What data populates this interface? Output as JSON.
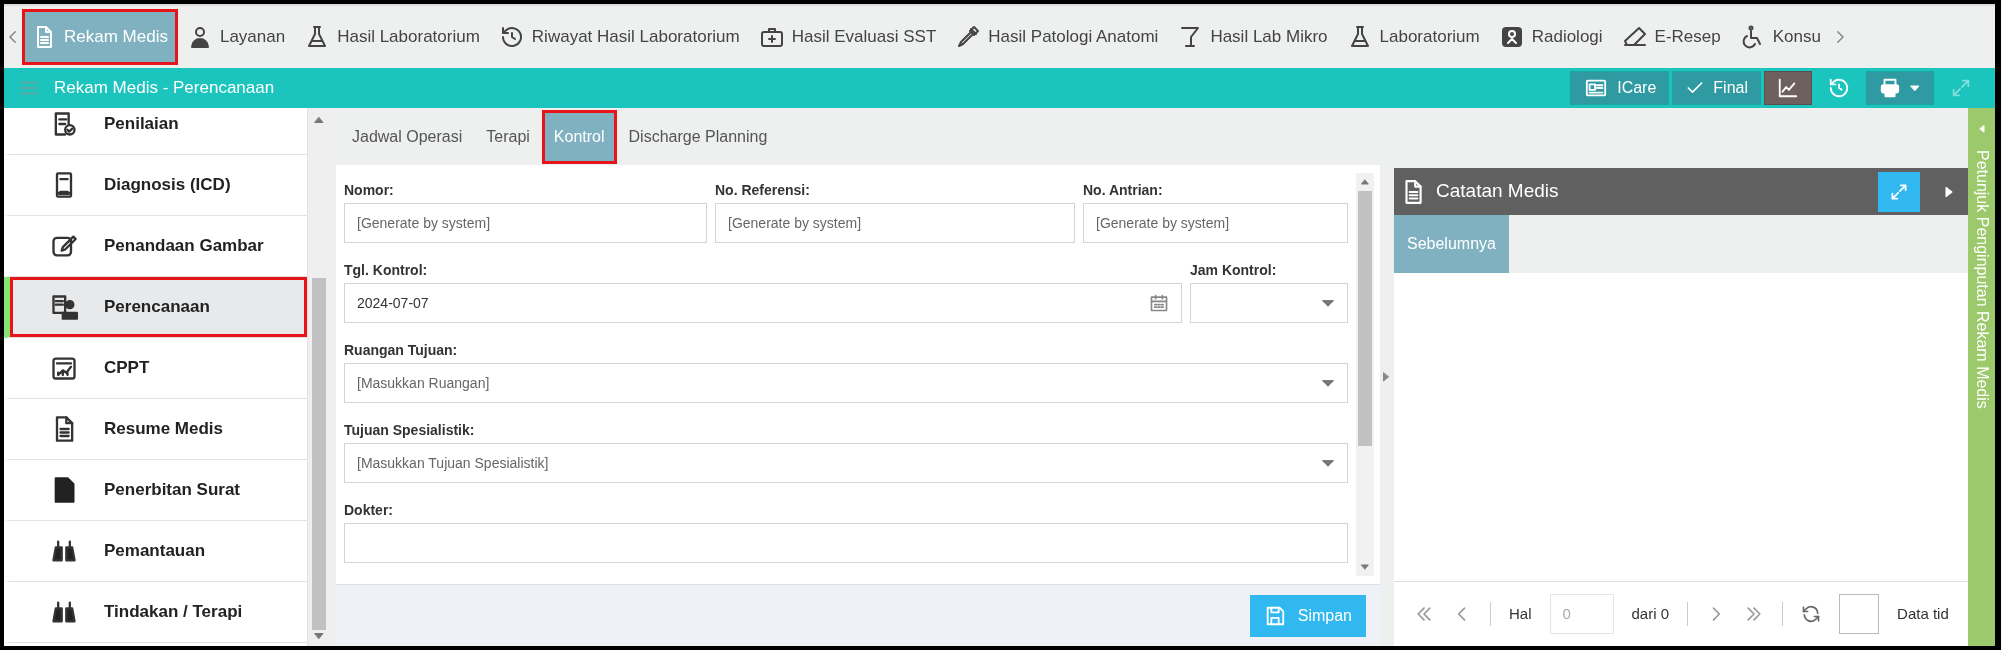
{
  "top_nav": {
    "items": [
      {
        "label": "Rekam Medis",
        "selected": true,
        "highlighted": true
      },
      {
        "label": "Layanan",
        "selected": false,
        "highlighted": false
      },
      {
        "label": "Hasil Laboratorium",
        "selected": false,
        "highlighted": false
      },
      {
        "label": "Riwayat Hasil Laboratorium",
        "selected": false,
        "highlighted": false
      },
      {
        "label": "Hasil Evaluasi SST",
        "selected": false,
        "highlighted": false
      },
      {
        "label": "Hasil Patologi Anatomi",
        "selected": false,
        "highlighted": false
      },
      {
        "label": "Hasil Lab Mikro",
        "selected": false,
        "highlighted": false
      },
      {
        "label": "Laboratorium",
        "selected": false,
        "highlighted": false
      },
      {
        "label": "Radiologi",
        "selected": false,
        "highlighted": false
      },
      {
        "label": "E-Resep",
        "selected": false,
        "highlighted": false
      },
      {
        "label": "Konsu",
        "selected": false,
        "highlighted": false
      }
    ]
  },
  "header": {
    "title": "Rekam Medis - Perencanaan",
    "buttons": [
      {
        "kind": "text",
        "label": "ICare",
        "selected": false
      },
      {
        "kind": "text",
        "label": "Final",
        "selected": false
      },
      {
        "kind": "chart",
        "selected": true
      },
      {
        "kind": "history",
        "selected": false
      },
      {
        "kind": "print",
        "selected": false
      },
      {
        "kind": "expand",
        "selected": false,
        "disabled": true
      }
    ]
  },
  "sidebar": {
    "items": [
      {
        "label": "Penilaian",
        "selected": false,
        "highlighted": false
      },
      {
        "label": "Diagnosis (ICD)",
        "selected": false,
        "highlighted": false
      },
      {
        "label": "Penandaan Gambar",
        "selected": false,
        "highlighted": false
      },
      {
        "label": "Perencanaan",
        "selected": true,
        "highlighted": true
      },
      {
        "label": "CPPT",
        "selected": false,
        "highlighted": false
      },
      {
        "label": "Resume Medis",
        "selected": false,
        "highlighted": false
      },
      {
        "label": "Penerbitan Surat",
        "selected": false,
        "highlighted": false
      },
      {
        "label": "Pemantauan",
        "selected": false,
        "highlighted": false
      },
      {
        "label": "Tindakan / Terapi",
        "selected": false,
        "highlighted": false
      }
    ]
  },
  "tabs": [
    {
      "label": "Jadwal Operasi",
      "selected": false,
      "highlighted": false
    },
    {
      "label": "Terapi",
      "selected": false,
      "highlighted": false
    },
    {
      "label": "Kontrol",
      "selected": true,
      "highlighted": true
    },
    {
      "label": "Discharge Planning",
      "selected": false,
      "highlighted": false
    }
  ],
  "form": {
    "rows": [
      [
        {
          "label": "Nomor:",
          "kind": "text",
          "placeholder": "[Generate by system]"
        },
        {
          "label": "No. Referensi:",
          "kind": "text",
          "placeholder": "[Generate by system]"
        },
        {
          "label": "No. Antrian:",
          "kind": "text",
          "placeholder": "[Generate by system]"
        }
      ],
      [
        {
          "label": "Tgl. Kontrol:",
          "kind": "date",
          "value": "2024-07-07"
        },
        {
          "label": "Jam Kontrol:",
          "kind": "select"
        }
      ],
      [
        {
          "label": "Ruangan Tujuan:",
          "kind": "select",
          "placeholder": "[Masukkan Ruangan]"
        }
      ],
      [
        {
          "label": "Tujuan Spesialistik:",
          "kind": "select",
          "placeholder": "[Masukkan Tujuan Spesialistik]"
        }
      ],
      [
        {
          "label": "Dokter:",
          "kind": "text"
        }
      ]
    ],
    "save_button": "Simpan"
  },
  "notes_panel": {
    "title": "Catatan Medis",
    "tabs": [
      {
        "label": "Sebelumnya",
        "selected": true
      }
    ],
    "pager": {
      "page_label": "Hal",
      "page_value": "0",
      "of_label": "dari 0",
      "status": "Data tid"
    }
  },
  "side_tab": {
    "label": "Petunjuk Penginputan Rekam Medis"
  }
}
